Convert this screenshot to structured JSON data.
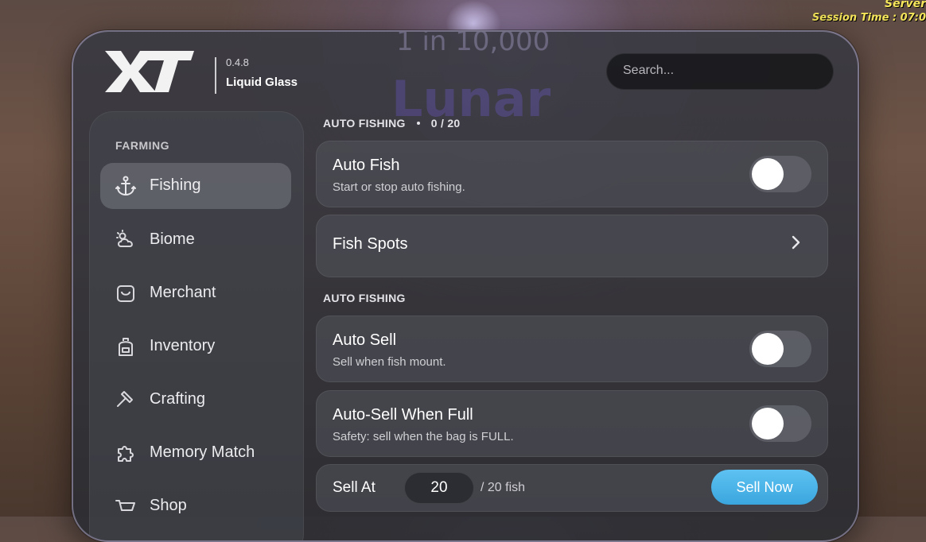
{
  "background": {
    "hud_line1": "Server",
    "hud_line2": "Session Time : 07:0",
    "overlay_title": "1 in 10,000",
    "overlay_word": "Lunar"
  },
  "header": {
    "logo_text": "XT",
    "version": "0.4.8",
    "theme_name": "Liquid Glass",
    "search_placeholder": "Search..."
  },
  "sidebar": {
    "section": "FARMING",
    "items": [
      {
        "label": "Fishing",
        "icon": "anchor-icon",
        "active": true
      },
      {
        "label": "Biome",
        "icon": "weather-icon",
        "active": false
      },
      {
        "label": "Merchant",
        "icon": "bag-icon",
        "active": false
      },
      {
        "label": "Inventory",
        "icon": "backpack-icon",
        "active": false
      },
      {
        "label": "Crafting",
        "icon": "hammer-icon",
        "active": false
      },
      {
        "label": "Memory Match",
        "icon": "puzzle-icon",
        "active": false
      },
      {
        "label": "Shop",
        "icon": "cart-icon",
        "active": false
      }
    ]
  },
  "main": {
    "section1": {
      "label": "AUTO FISHING",
      "count": "0 / 20"
    },
    "auto_fish": {
      "title": "Auto Fish",
      "desc": "Start or stop auto fishing.",
      "enabled": false
    },
    "fish_spots": {
      "title": "Fish Spots"
    },
    "section2": {
      "label": "AUTO FISHING"
    },
    "auto_sell": {
      "title": "Auto Sell",
      "desc": "Sell when fish mount.",
      "enabled": false
    },
    "auto_sell_full": {
      "title": "Auto-Sell When Full",
      "desc": "Safety: sell when the bag is FULL.",
      "enabled": false
    },
    "sell_at": {
      "label": "Sell At",
      "value": "20",
      "suffix": "/ 20 fish",
      "button": "Sell Now"
    }
  },
  "colors": {
    "accent": "#4bb4e8",
    "panel": "#2e2f35",
    "text": "#ffffff"
  }
}
